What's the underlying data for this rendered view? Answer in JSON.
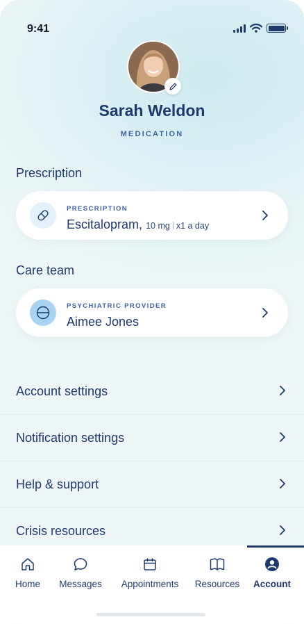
{
  "status_bar": {
    "time": "9:41"
  },
  "profile": {
    "name": "Sarah Weldon",
    "subtitle": "MEDICATION"
  },
  "prescription_section": {
    "title": "Prescription",
    "card": {
      "kicker": "PRESCRIPTION",
      "drug": "Escitalopram,",
      "dose": "10 mg",
      "frequency": "x1 a day"
    }
  },
  "care_team_section": {
    "title": "Care team",
    "card": {
      "kicker": "PSYCHIATRIC PROVIDER",
      "name": "Aimee Jones"
    }
  },
  "settings": {
    "items": [
      {
        "label": "Account settings"
      },
      {
        "label": "Notification settings"
      },
      {
        "label": "Help & support"
      },
      {
        "label": "Crisis resources"
      }
    ]
  },
  "tabbar": {
    "tabs": [
      {
        "label": "Home",
        "icon": "home-icon"
      },
      {
        "label": "Messages",
        "icon": "chat-bubble-icon"
      },
      {
        "label": "Appointments",
        "icon": "calendar-icon"
      },
      {
        "label": "Resources",
        "icon": "book-icon"
      },
      {
        "label": "Account",
        "icon": "account-icon"
      }
    ],
    "active": "Account"
  },
  "colors": {
    "primary": "#1e3a6e",
    "accent": "#3f64a6",
    "pill_icon_bg": "#e1f0fb",
    "provider_icon_bg": "#a8d3f3"
  }
}
